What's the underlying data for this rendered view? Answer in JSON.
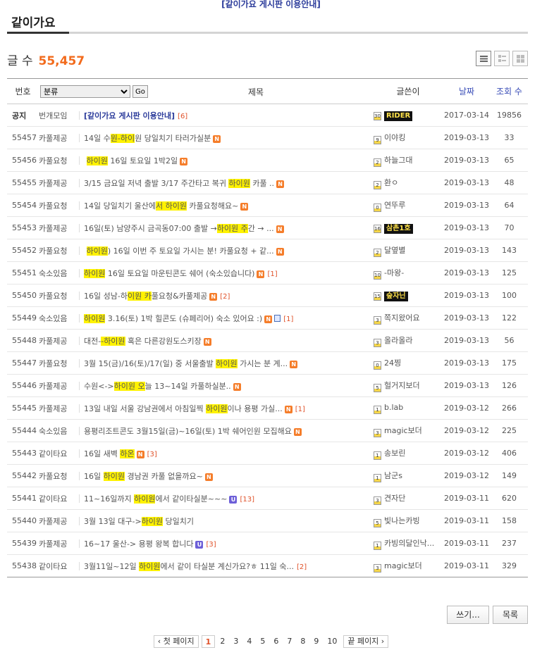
{
  "notice_link": "[같이가요 게시판 이용안내]",
  "board": {
    "title": "같이가요",
    "count_label": "글 수",
    "count_value": "55,457"
  },
  "header": {
    "no": "번호",
    "category_default": "분류",
    "go": "Go",
    "title": "제목",
    "author": "글쓴이",
    "date": "날짜",
    "views": "조회 수"
  },
  "rows": [
    {
      "no": "공지",
      "cat": "번개모임",
      "pre": "",
      "hl": "",
      "post": "[같이가요 게시판 이용안내]",
      "new": false,
      "upd": false,
      "file": false,
      "cmt": "[6]",
      "lvl": "30",
      "author": "RIDER",
      "author_img": true,
      "date": "2017-03-14",
      "views": "19856",
      "notice": true
    },
    {
      "no": "55457",
      "cat": "카풀제공",
      "pre": "14일 수",
      "hl": "원-하이",
      "post": "원 당일치기 타러가실분",
      "new": true,
      "upd": false,
      "file": false,
      "cmt": "",
      "lvl": "9",
      "author": "이야킹",
      "author_img": false,
      "date": "2019-03-13",
      "views": "33",
      "notice": false
    },
    {
      "no": "55456",
      "cat": "카풀요청",
      "pre": " ",
      "hl": "하이원",
      "post": " 16일 토요일 1박2일",
      "new": true,
      "upd": false,
      "file": false,
      "cmt": "",
      "lvl": "2",
      "author": "하늘그대",
      "author_img": false,
      "date": "2019-03-13",
      "views": "65",
      "notice": false
    },
    {
      "no": "55455",
      "cat": "카풀제공",
      "pre": "3/15 금요일 저녁 출발 3/17 주간타고 복귀 ",
      "hl": "하이원",
      "post": " 카풀 ..",
      "new": true,
      "upd": false,
      "file": false,
      "cmt": "",
      "lvl": "2",
      "author": "환ㅇ",
      "author_img": false,
      "date": "2019-03-13",
      "views": "48",
      "notice": false
    },
    {
      "no": "55454",
      "cat": "카풀요청",
      "pre": "14일 당일치기 울산에",
      "hl": "서 하이원",
      "post": " 카풀요청해요~",
      "new": true,
      "upd": false,
      "file": false,
      "cmt": "",
      "lvl": "0",
      "author": "연뚜루",
      "author_img": false,
      "date": "2019-03-13",
      "views": "64",
      "notice": false
    },
    {
      "no": "55453",
      "cat": "카풀제공",
      "pre": "16일(토) 남양주시 금곡동07:00 출발 →",
      "hl": "하이원 주",
      "post": "간 → ...",
      "new": true,
      "upd": false,
      "file": false,
      "cmt": "",
      "lvl": "16",
      "author": "삼촌1호",
      "author_img": true,
      "date": "2019-03-13",
      "views": "70",
      "notice": false
    },
    {
      "no": "55452",
      "cat": "카풀요청",
      "pre": " ",
      "hl": "하이원",
      "post": ") 16일 이번 주 토요일 가시는 분! 카풀요청 + 같...",
      "new": true,
      "upd": false,
      "file": false,
      "cmt": "",
      "lvl": "2",
      "author": "달옆별",
      "author_img": false,
      "date": "2019-03-13",
      "views": "143",
      "notice": false
    },
    {
      "no": "55451",
      "cat": "숙소있음",
      "pre": "",
      "hl": "하이원",
      "post": " 16일 토요일 마운틴콘도 쉐어 (숙소있습니다)",
      "new": true,
      "upd": false,
      "file": false,
      "cmt": "[1]",
      "lvl": "10",
      "author": "-마왕-",
      "author_img": false,
      "date": "2019-03-13",
      "views": "125",
      "notice": false
    },
    {
      "no": "55450",
      "cat": "카풀요청",
      "pre": "16일 성남-하",
      "hl": "이원 카",
      "post": "풀요청&카풀제공",
      "new": true,
      "upd": false,
      "file": false,
      "cmt": "[2]",
      "lvl": "15",
      "author": "숲자닌",
      "author_img": true,
      "date": "2019-03-13",
      "views": "100",
      "notice": false
    },
    {
      "no": "55449",
      "cat": "숙소있음",
      "pre": "",
      "hl": "하이원",
      "post": " 3.16(토) 1박 힐콘도 (슈페리어) 숙소 있어요 :)",
      "new": true,
      "upd": false,
      "file": true,
      "cmt": "[1]",
      "lvl": "3",
      "author": "쪽지왔어요",
      "author_img": false,
      "date": "2019-03-13",
      "views": "122",
      "notice": false
    },
    {
      "no": "55448",
      "cat": "카풀제공",
      "pre": "대전-",
      "hl": "-하이원",
      "post": " 혹은 다른강원도스키장",
      "new": true,
      "upd": false,
      "file": false,
      "cmt": "",
      "lvl": "3",
      "author": "올라올라",
      "author_img": false,
      "date": "2019-03-13",
      "views": "56",
      "notice": false
    },
    {
      "no": "55447",
      "cat": "카풀요청",
      "pre": "3월 15(금)/16(토)/17(일) 중 서울출발 ",
      "hl": "하이원",
      "post": " 가시는 분 계...",
      "new": true,
      "upd": false,
      "file": false,
      "cmt": "",
      "lvl": "0",
      "author": "24찡",
      "author_img": false,
      "date": "2019-03-13",
      "views": "175",
      "notice": false
    },
    {
      "no": "55446",
      "cat": "카풀제공",
      "pre": "수원<->",
      "hl": "하이원 오",
      "post": "늘 13~14일 카풀하실분..",
      "new": true,
      "upd": false,
      "file": false,
      "cmt": "",
      "lvl": "5",
      "author": "헐거지보더",
      "author_img": false,
      "date": "2019-03-13",
      "views": "126",
      "notice": false
    },
    {
      "no": "55445",
      "cat": "카풀제공",
      "pre": "13일 내일 서울 강남권에서 아침일찍 ",
      "hl": "하이원",
      "post": "이나 용평 가실...",
      "new": true,
      "upd": false,
      "file": false,
      "cmt": "[1]",
      "lvl": "1",
      "author": "b.lab",
      "author_img": false,
      "date": "2019-03-12",
      "views": "266",
      "notice": false
    },
    {
      "no": "55444",
      "cat": "숙소있음",
      "pre": "용평리조트콘도 3월15일(금)~16일(토) 1박 쉐어인원 모집해요",
      "hl": "",
      "post": "",
      "new": true,
      "upd": false,
      "file": false,
      "cmt": "",
      "lvl": "3",
      "author": "magic보더",
      "author_img": false,
      "date": "2019-03-12",
      "views": "225",
      "notice": false
    },
    {
      "no": "55443",
      "cat": "같이타요",
      "pre": "16일 새벽 ",
      "hl": "하온",
      "post": "",
      "new": true,
      "upd": false,
      "file": false,
      "cmt": "[3]",
      "lvl": "1",
      "author": "송보린",
      "author_img": false,
      "date": "2019-03-12",
      "views": "406",
      "notice": false
    },
    {
      "no": "55442",
      "cat": "카풀요청",
      "pre": "16일 ",
      "hl": "하이원",
      "post": " 경남권 카풀 없을까요~",
      "new": true,
      "upd": false,
      "file": false,
      "cmt": "",
      "lvl": "1",
      "author": "남군s",
      "author_img": false,
      "date": "2019-03-12",
      "views": "149",
      "notice": false
    },
    {
      "no": "55441",
      "cat": "같이타요",
      "pre": "11~16일까지 ",
      "hl": "하이원",
      "post": "에서 같이타실분~~~",
      "new": false,
      "upd": true,
      "file": false,
      "cmt": "[13]",
      "lvl": "3",
      "author": "견자단",
      "author_img": false,
      "date": "2019-03-11",
      "views": "620",
      "notice": false
    },
    {
      "no": "55440",
      "cat": "카풀제공",
      "pre": "3월 13일 대구->",
      "hl": "하이원",
      "post": " 당일치기",
      "new": false,
      "upd": false,
      "file": false,
      "cmt": "",
      "lvl": "5",
      "author": "빛나는카빙",
      "author_img": false,
      "date": "2019-03-11",
      "views": "158",
      "notice": false
    },
    {
      "no": "55439",
      "cat": "카풀제공",
      "pre": "16~17 울산-> 용평 왕복 합니다",
      "hl": "",
      "post": "",
      "new": false,
      "upd": true,
      "file": false,
      "cmt": "[3]",
      "lvl": "1",
      "author": "카빙의달인낙...",
      "author_img": false,
      "date": "2019-03-11",
      "views": "237",
      "notice": false
    },
    {
      "no": "55438",
      "cat": "같이타요",
      "pre": "3월11일~12일 ",
      "hl": "하이원",
      "post": "에서 같이 타실분 계신가요?ㅎ 11일 숙...",
      "new": false,
      "upd": false,
      "file": false,
      "cmt": "[2]",
      "lvl": "3",
      "author": "magic보더",
      "author_img": false,
      "date": "2019-03-11",
      "views": "329",
      "notice": false
    }
  ],
  "buttons": {
    "write": "쓰기...",
    "list": "목록"
  },
  "pagination": {
    "first": "‹ 첫 페이지",
    "last": "끝 페이지 ›",
    "pages": [
      "1",
      "2",
      "3",
      "4",
      "5",
      "6",
      "7",
      "8",
      "9",
      "10"
    ],
    "current": "1"
  },
  "colors": {
    "accent": "#f26b1d",
    "highlight": "#fff200",
    "link_blue": "#2a3a9a",
    "comment": "#e0522a"
  }
}
